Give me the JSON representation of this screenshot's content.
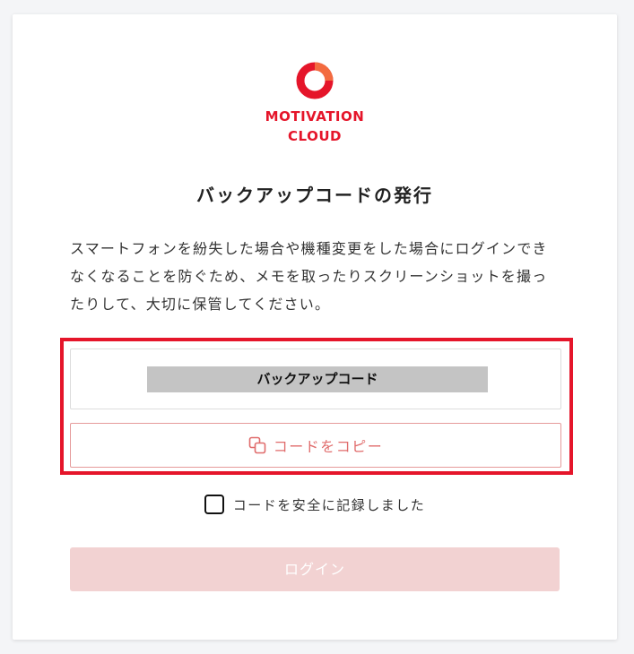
{
  "brand": {
    "name_line1": "MOTIVATION",
    "name_line2": "CLOUD",
    "color": "#e5152a"
  },
  "page": {
    "title": "バックアップコードの発行",
    "description": "スマートフォンを紛失した場合や機種変更をした場合にログインできなくなることを防ぐため、メモを取ったりスクリーンショットを撮ったりして、大切に保管してください。"
  },
  "backup_code": {
    "label": "バックアップコード",
    "masked": true
  },
  "copy_button": {
    "label": "コードをコピー",
    "icon": "copy-icon"
  },
  "confirm": {
    "label": "コードを安全に記録しました",
    "checked": false
  },
  "login_button": {
    "label": "ログイン",
    "disabled": true
  },
  "colors": {
    "accent": "#e5152a",
    "button_disabled": "#f2d2d2",
    "copy_text": "#e06c6c"
  }
}
